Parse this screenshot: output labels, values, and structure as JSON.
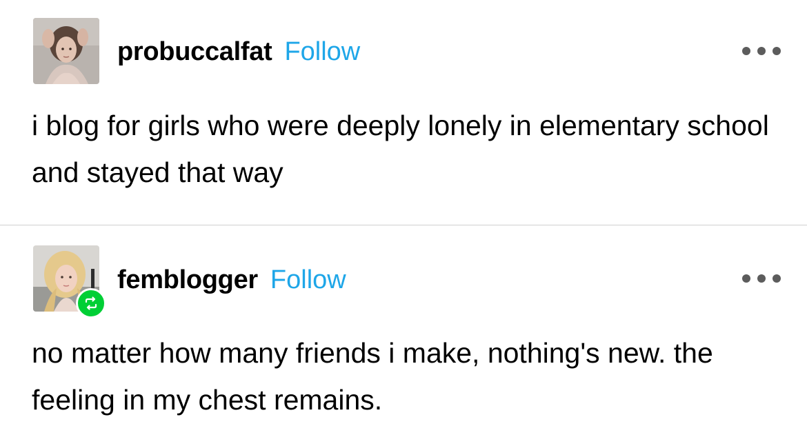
{
  "posts": [
    {
      "username": "probuccalfat",
      "follow_label": "Follow",
      "text": "i blog for girls who were deeply lonely in elementary school and stayed that way",
      "avatar_icon": "avatar-photo",
      "more_icon": "more-options-icon"
    },
    {
      "username": "femblogger",
      "follow_label": "Follow",
      "text": "no matter how many friends i make, nothing's new. the feeling in my chest remains.",
      "avatar_icon": "avatar-photo",
      "more_icon": "more-options-icon",
      "badge_icon": "reblog-icon"
    }
  ],
  "colors": {
    "follow": "#1ea6e8",
    "reblog_badge": "#00cf35",
    "divider": "#cfcfcf"
  }
}
